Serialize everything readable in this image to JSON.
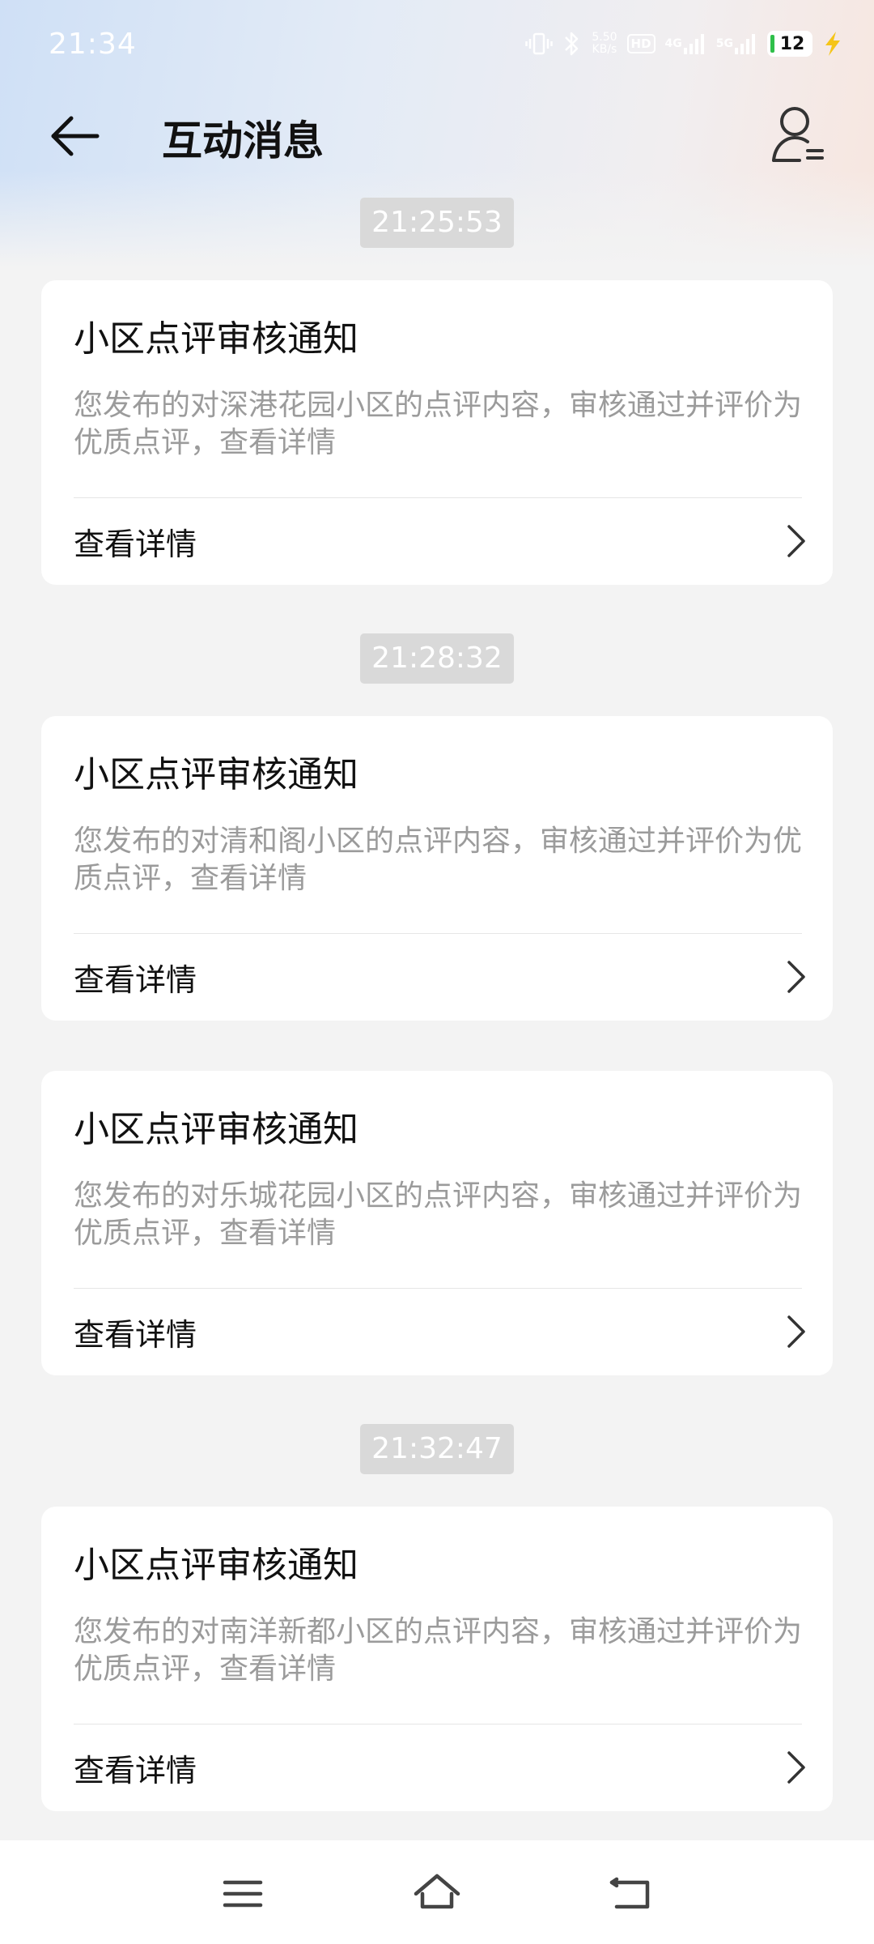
{
  "status_bar": {
    "time": "21:34",
    "net_speed_value": "5.50",
    "net_speed_unit": "KB/s",
    "hd_label": "HD",
    "network_4g": "4G",
    "network_5g": "5G",
    "battery_level": "12",
    "icons": [
      "vibrate-icon",
      "bluetooth-icon",
      "hd-call-icon",
      "signal-4g-icon",
      "signal-5g-icon",
      "battery-icon",
      "charging-icon"
    ]
  },
  "header": {
    "title": "互动消息",
    "back_icon": "arrow-left-icon",
    "profile_icon": "user-settings-icon"
  },
  "messages": [
    {
      "timestamp": "21:25:53",
      "title": "小区点评审核通知",
      "body": "您发布的对深港花园小区的点评内容，审核通过并评价为优质点评，查看详情",
      "link_label": "查看详情"
    },
    {
      "timestamp": "21:28:32",
      "title": "小区点评审核通知",
      "body": "您发布的对清和阁小区的点评内容，审核通过并评价为优质点评，查看详情",
      "link_label": "查看详情"
    },
    {
      "timestamp": "",
      "title": "小区点评审核通知",
      "body": "您发布的对乐城花园小区的点评内容，审核通过并评价为优质点评，查看详情",
      "link_label": "查看详情"
    },
    {
      "timestamp": "21:32:47",
      "title": "小区点评审核通知",
      "body": "您发布的对南洋新都小区的点评内容，审核通过并评价为优质点评，查看详情",
      "link_label": "查看详情"
    }
  ],
  "nav_bar": {
    "icons": [
      "menu-icon",
      "home-icon",
      "back-icon"
    ]
  },
  "colors": {
    "page_background": "#f3f3f3",
    "card_background": "#ffffff",
    "timestamp_background": "#d9d9d9",
    "body_text": "#9b9b9b",
    "battery_level": "#2fbf4a",
    "charging_bolt": "#f5c518"
  }
}
